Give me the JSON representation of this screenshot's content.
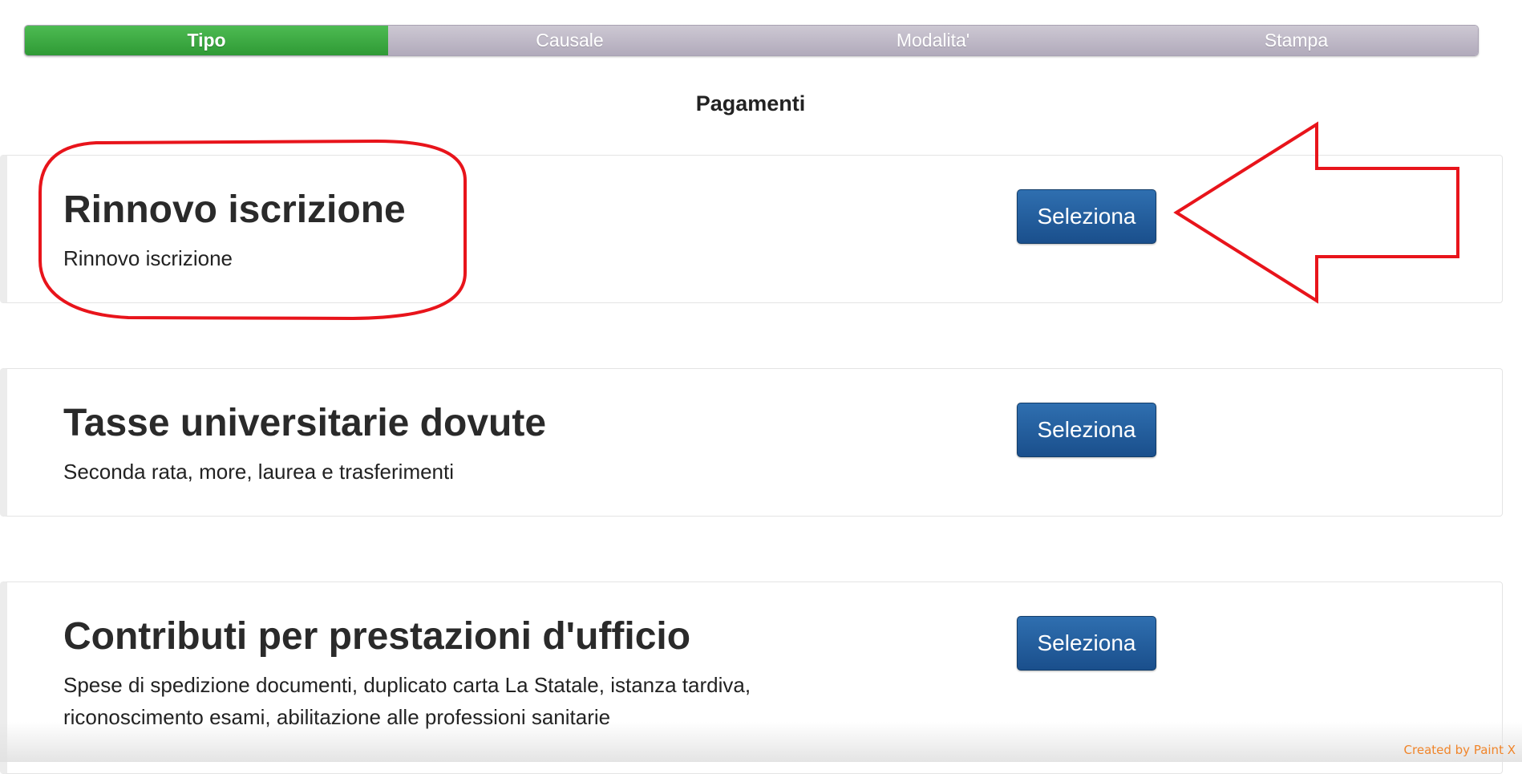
{
  "wizard": {
    "steps": [
      {
        "label": "Tipo",
        "active": true
      },
      {
        "label": "Causale",
        "active": false
      },
      {
        "label": "Modalita'",
        "active": false
      },
      {
        "label": "Stampa",
        "active": false
      }
    ],
    "active_color": "#3aa83f",
    "inactive_color": "#bdb7c6"
  },
  "page_title": "Pagamenti",
  "cards": [
    {
      "title": "Rinnovo iscrizione",
      "description": "Rinnovo iscrizione",
      "button_label": "Seleziona"
    },
    {
      "title": "Tasse universitarie dovute",
      "description": "Seconda rata, more, laurea e trasferimenti",
      "button_label": "Seleziona"
    },
    {
      "title": "Contributi per prestazioni d'ufficio",
      "description": "Spese di spedizione documenti, duplicato carta La Statale, istanza tardiva, riconoscimento esami, abilitazione alle professioni sanitarie",
      "button_label": "Seleziona"
    }
  ],
  "annotations": {
    "color": "#e8141b",
    "shapes": [
      "highlight-ellipse",
      "arrow-pointing-left"
    ]
  },
  "watermark": "Created by Paint X",
  "colors": {
    "button": "#1f5a98",
    "watermark": "#f0852a"
  }
}
